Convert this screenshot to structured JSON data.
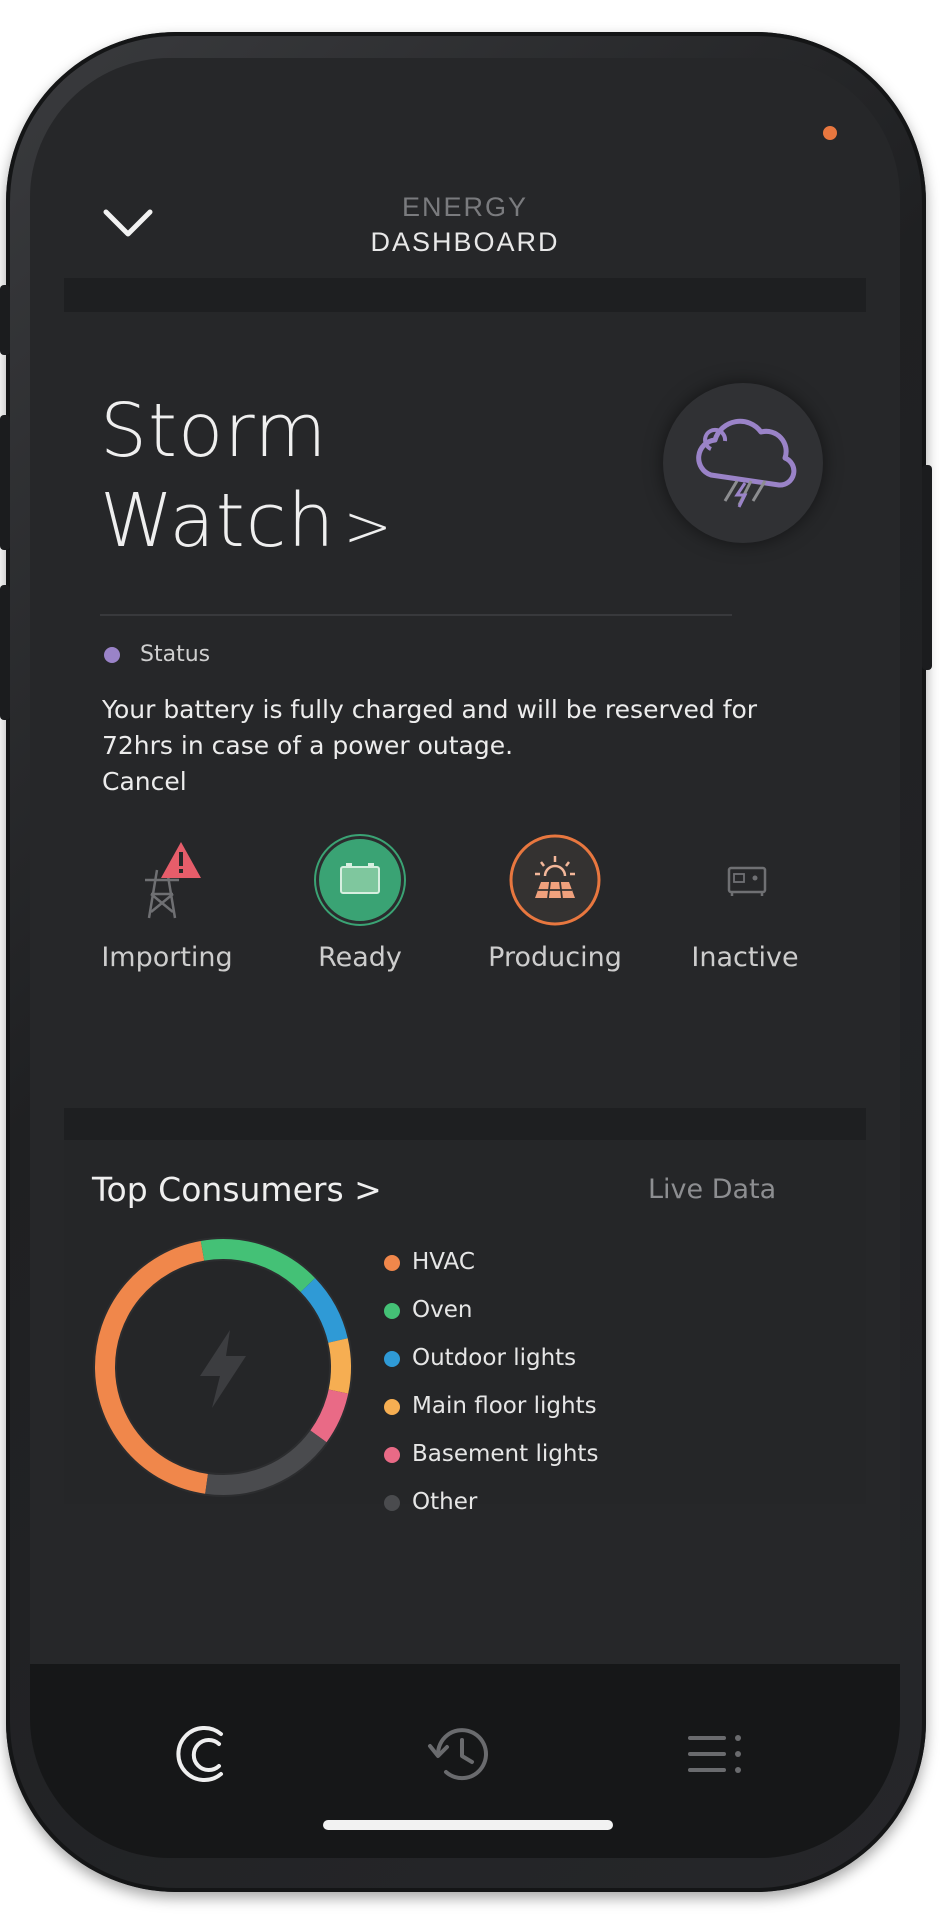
{
  "header": {
    "title_line1": "ENERGY",
    "title_line2": "DASHBOARD"
  },
  "storm_watch": {
    "title_line1": "Storm",
    "title_line2": "Watch",
    "arrow": ">",
    "status_label": "Status",
    "status_message": "Your battery is fully charged and will be reserved for 72hrs in case of a power outage.",
    "cancel_label": "Cancel",
    "accent_color": "#9a83c8"
  },
  "states": [
    {
      "label": "Importing",
      "icon": "power-tower-warning-icon"
    },
    {
      "label": "Ready",
      "icon": "battery-icon",
      "color": "#3aa374"
    },
    {
      "label": "Producing",
      "icon": "solar-panel-icon",
      "color": "#e8773f"
    },
    {
      "label": "Inactive",
      "icon": "generator-icon"
    }
  ],
  "top_consumers": {
    "title": "Top Consumers",
    "arrow": ">",
    "live_label": "Live Data",
    "legend": [
      {
        "label": "HVAC",
        "color": "#f0874b"
      },
      {
        "label": "Oven",
        "color": "#44c176"
      },
      {
        "label": "Outdoor lights",
        "color": "#2f9ad6"
      },
      {
        "label": "Main floor lights",
        "color": "#f6ae52"
      },
      {
        "label": "Basement lights",
        "color": "#e96a86"
      },
      {
        "label": "Other",
        "color": "#4a4b4e"
      }
    ]
  },
  "nav": {
    "items": [
      "home-icon",
      "history-icon",
      "menu-icon"
    ]
  }
}
